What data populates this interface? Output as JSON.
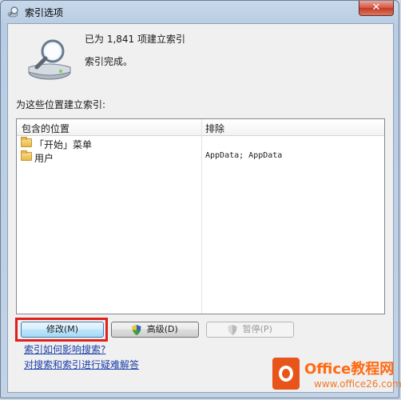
{
  "window": {
    "title": "索引选项",
    "close_glyph": "✕"
  },
  "summary": {
    "count_text": "已为 1,841 项建立索引",
    "status_text": "索引完成。"
  },
  "section_label": "为这些位置建立索引:",
  "table": {
    "columns": [
      "包含的位置",
      "排除"
    ],
    "rows": [
      {
        "location": "「开始」菜单",
        "exclude": ""
      },
      {
        "location": "用户",
        "exclude": "AppData; AppData"
      }
    ]
  },
  "buttons": {
    "modify": "修改(M)",
    "advanced": "高级(D)",
    "pause": "暂停(P)"
  },
  "links": {
    "how_affects": "索引如何影响搜索?",
    "troubleshoot": "对搜索和索引进行疑难解答"
  },
  "watermark": {
    "title": "Office教程网",
    "url": "www.office26.com"
  },
  "icons": {
    "title": "indexing-options-icon",
    "status": "magnifier-drive-icon",
    "folder": "folder-icon",
    "shield": "uac-shield-icon"
  },
  "colors": {
    "highlight": "#e0201b",
    "link": "#1a3ea8",
    "watermark_orange": "#ff6a13"
  }
}
